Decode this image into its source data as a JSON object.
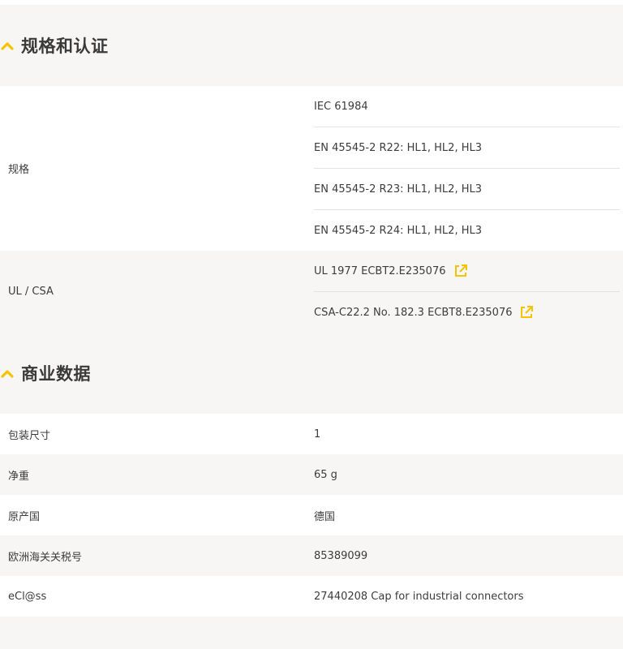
{
  "sections": [
    {
      "title": "规格和认证",
      "rows": [
        {
          "label": "规格",
          "values": [
            "IEC 61984",
            "EN 45545-2 R22: HL1, HL2, HL3",
            "EN 45545-2 R23: HL1, HL2, HL3",
            "EN 45545-2 R24: HL1, HL2, HL3"
          ]
        },
        {
          "label": "UL / CSA",
          "values": [
            "UL 1977 ECBT2.E235076",
            "CSA-C22.2 No. 182.3 ECBT8.E235076"
          ],
          "link_icon": "external-link-icon"
        }
      ]
    },
    {
      "title": "商业数据",
      "rows": [
        {
          "label": "包装尺寸",
          "value": "1"
        },
        {
          "label": "净重",
          "value": "65 g"
        },
        {
          "label": "原产国",
          "value": "德国"
        },
        {
          "label": "欧洲海关关税号",
          "value": "85389099"
        },
        {
          "label": "eCl@ss",
          "value": "27440208 Cap for industrial connectors"
        }
      ]
    }
  ],
  "colors": {
    "accent": "#f5c400",
    "background_grey": "#f7f6f4",
    "row_white": "#ffffff",
    "divider": "#e2e2e2",
    "text": "#3c3c3c"
  },
  "icons": {
    "section_toggle": "chevron-up-icon",
    "external_link": "external-link-icon"
  }
}
